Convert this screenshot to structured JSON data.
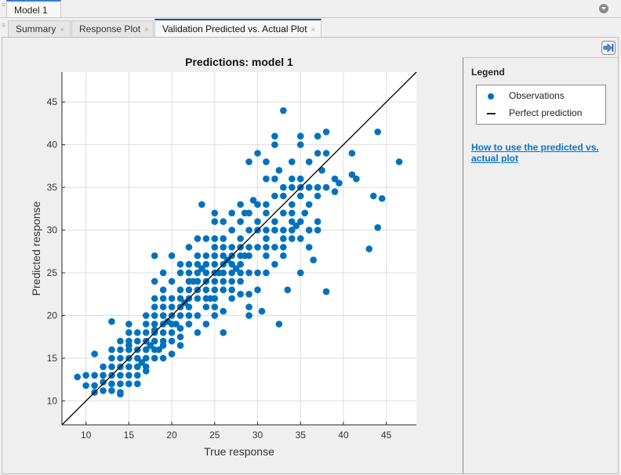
{
  "window": {
    "model_tab": "Model 1",
    "tabs": [
      {
        "label": "Summary",
        "close": "×",
        "active": false
      },
      {
        "label": "Response Plot",
        "close": "×",
        "active": false
      },
      {
        "label": "Validation Predicted vs. Actual Plot",
        "close": "×",
        "active": true
      }
    ]
  },
  "side_panel": {
    "legend_title": "Legend",
    "legend_items": [
      {
        "label": "Observations",
        "icon": "blue-dot"
      },
      {
        "label": "Perfect prediction",
        "icon": "black-line"
      }
    ],
    "help_link": "How to use the predicted vs. actual plot"
  },
  "colors": {
    "marker": "#0072bd",
    "line": "#000000",
    "link": "#0b73c9"
  },
  "chart_data": {
    "type": "scatter",
    "title": "Predictions: model 1",
    "xlabel": "True response",
    "ylabel": "Predicted response",
    "xlim": [
      7.2,
      48.5
    ],
    "ylim": [
      7.2,
      48.5
    ],
    "xticks": [
      10,
      15,
      20,
      25,
      30,
      35,
      40,
      45
    ],
    "yticks": [
      10,
      15,
      20,
      25,
      30,
      35,
      40,
      45
    ],
    "grid": true,
    "series": [
      {
        "name": "Observations",
        "kind": "scatter",
        "points": [
          [
            9,
            12.8
          ],
          [
            10,
            13
          ],
          [
            11,
            13
          ],
          [
            11,
            15.5
          ],
          [
            10,
            11.8
          ],
          [
            11,
            11.8
          ],
          [
            11,
            11
          ],
          [
            12,
            11.2
          ],
          [
            12,
            12.2
          ],
          [
            12,
            13
          ],
          [
            12,
            14
          ],
          [
            13,
            13
          ],
          [
            13,
            14
          ],
          [
            13,
            15
          ],
          [
            13,
            16
          ],
          [
            13,
            12
          ],
          [
            13,
            11.2
          ],
          [
            13,
            19.3
          ],
          [
            14,
            11
          ],
          [
            14,
            12
          ],
          [
            14,
            13
          ],
          [
            14,
            14
          ],
          [
            14,
            15
          ],
          [
            14,
            16
          ],
          [
            14,
            17
          ],
          [
            14,
            10.8
          ],
          [
            15,
            12
          ],
          [
            15,
            13
          ],
          [
            15,
            14
          ],
          [
            15,
            15
          ],
          [
            15,
            16
          ],
          [
            15,
            17
          ],
          [
            15,
            18
          ],
          [
            15,
            19
          ],
          [
            15,
            16.5
          ],
          [
            16,
            13
          ],
          [
            16,
            14
          ],
          [
            16,
            15
          ],
          [
            16,
            16
          ],
          [
            16,
            17
          ],
          [
            16,
            18
          ],
          [
            16,
            12
          ],
          [
            16.5,
            14.5
          ],
          [
            17,
            15
          ],
          [
            17,
            16
          ],
          [
            17,
            17
          ],
          [
            17,
            18
          ],
          [
            17,
            19
          ],
          [
            17,
            20
          ],
          [
            17,
            14
          ],
          [
            17,
            13.5
          ],
          [
            17.5,
            16.5
          ],
          [
            18,
            15
          ],
          [
            18,
            16
          ],
          [
            18,
            17
          ],
          [
            18,
            18
          ],
          [
            18,
            19
          ],
          [
            18,
            20
          ],
          [
            18,
            21
          ],
          [
            18,
            22
          ],
          [
            18,
            24
          ],
          [
            18,
            27
          ],
          [
            18,
            18.3
          ],
          [
            18.5,
            16
          ],
          [
            19,
            16.5
          ],
          [
            19,
            17
          ],
          [
            19,
            18
          ],
          [
            19,
            19
          ],
          [
            19,
            20
          ],
          [
            19,
            21
          ],
          [
            19,
            22
          ],
          [
            19,
            23
          ],
          [
            19,
            25
          ],
          [
            19,
            15
          ],
          [
            19.5,
            19.3
          ],
          [
            20,
            17
          ],
          [
            20,
            18
          ],
          [
            20,
            19
          ],
          [
            20,
            20
          ],
          [
            20,
            21
          ],
          [
            20,
            22
          ],
          [
            20,
            24
          ],
          [
            20,
            27
          ],
          [
            20,
            15.5
          ],
          [
            20.5,
            19
          ],
          [
            21,
            17.5
          ],
          [
            21,
            18.5
          ],
          [
            21,
            20
          ],
          [
            21,
            21
          ],
          [
            21,
            22
          ],
          [
            21,
            23
          ],
          [
            21,
            25
          ],
          [
            21,
            26
          ],
          [
            21,
            16.5
          ],
          [
            21.5,
            21.5
          ],
          [
            22,
            19
          ],
          [
            22,
            20
          ],
          [
            22,
            21
          ],
          [
            22,
            22
          ],
          [
            22,
            23
          ],
          [
            22,
            24
          ],
          [
            22,
            25
          ],
          [
            22,
            26
          ],
          [
            22,
            28
          ],
          [
            22.5,
            24
          ],
          [
            23,
            18
          ],
          [
            23,
            20
          ],
          [
            23,
            22
          ],
          [
            23,
            23
          ],
          [
            23,
            24
          ],
          [
            23,
            25
          ],
          [
            23,
            26
          ],
          [
            23,
            27
          ],
          [
            23,
            29
          ],
          [
            23.5,
            33
          ],
          [
            23.5,
            25.5
          ],
          [
            24,
            19
          ],
          [
            24,
            21
          ],
          [
            24,
            22
          ],
          [
            24,
            23
          ],
          [
            24,
            24
          ],
          [
            24,
            25
          ],
          [
            24,
            26
          ],
          [
            24,
            27
          ],
          [
            24,
            29
          ],
          [
            24.5,
            22
          ],
          [
            25,
            20
          ],
          [
            25,
            21
          ],
          [
            25,
            22
          ],
          [
            25,
            23
          ],
          [
            25,
            24
          ],
          [
            25,
            25
          ],
          [
            25,
            26
          ],
          [
            25,
            27
          ],
          [
            25,
            28
          ],
          [
            25,
            29
          ],
          [
            25,
            31
          ],
          [
            25,
            32
          ],
          [
            25.5,
            25
          ],
          [
            26,
            20.5
          ],
          [
            26,
            23
          ],
          [
            26,
            24
          ],
          [
            26,
            25
          ],
          [
            26,
            26
          ],
          [
            26,
            27
          ],
          [
            26,
            28
          ],
          [
            26,
            29
          ],
          [
            26,
            31
          ],
          [
            26,
            18
          ],
          [
            26.5,
            26.5
          ],
          [
            27,
            22
          ],
          [
            27,
            23
          ],
          [
            27,
            24
          ],
          [
            27,
            25
          ],
          [
            27,
            26
          ],
          [
            27,
            27
          ],
          [
            27,
            28
          ],
          [
            27,
            30
          ],
          [
            27,
            32
          ],
          [
            27.5,
            25.5
          ],
          [
            28,
            22.5
          ],
          [
            28,
            24
          ],
          [
            28,
            25
          ],
          [
            28,
            26
          ],
          [
            28,
            27
          ],
          [
            28,
            28
          ],
          [
            28,
            29
          ],
          [
            28,
            31
          ],
          [
            28,
            33
          ],
          [
            28.5,
            27
          ],
          [
            28.5,
            32
          ],
          [
            29,
            20
          ],
          [
            29,
            22.5
          ],
          [
            29,
            25
          ],
          [
            29,
            27
          ],
          [
            29,
            28
          ],
          [
            29,
            30
          ],
          [
            29,
            32
          ],
          [
            29,
            38
          ],
          [
            29,
            21
          ],
          [
            29.5,
            33.5
          ],
          [
            30,
            23
          ],
          [
            30,
            25
          ],
          [
            30,
            28
          ],
          [
            30,
            30
          ],
          [
            30,
            31
          ],
          [
            30,
            33
          ],
          [
            30,
            39
          ],
          [
            30.5,
            20.5
          ],
          [
            31,
            25
          ],
          [
            31,
            27
          ],
          [
            31,
            28
          ],
          [
            31,
            29
          ],
          [
            31,
            30
          ],
          [
            31,
            32
          ],
          [
            31,
            33
          ],
          [
            31,
            36
          ],
          [
            31,
            38
          ],
          [
            32,
            26
          ],
          [
            32,
            28
          ],
          [
            32,
            30
          ],
          [
            32,
            31
          ],
          [
            32,
            34
          ],
          [
            32,
            36
          ],
          [
            32,
            40
          ],
          [
            32,
            41
          ],
          [
            32.5,
            37
          ],
          [
            32.5,
            19
          ],
          [
            33,
            27
          ],
          [
            33,
            28
          ],
          [
            33,
            29
          ],
          [
            33,
            30
          ],
          [
            33,
            32
          ],
          [
            33,
            34
          ],
          [
            33,
            35
          ],
          [
            33,
            44
          ],
          [
            33.5,
            23
          ],
          [
            34,
            29
          ],
          [
            34,
            30
          ],
          [
            34,
            31
          ],
          [
            34,
            32
          ],
          [
            34,
            33
          ],
          [
            34,
            35
          ],
          [
            34,
            36
          ],
          [
            34,
            38
          ],
          [
            34.5,
            30.5
          ],
          [
            35,
            25
          ],
          [
            35,
            29
          ],
          [
            35,
            31
          ],
          [
            35,
            34
          ],
          [
            35,
            35
          ],
          [
            35,
            36
          ],
          [
            35,
            40
          ],
          [
            35,
            41
          ],
          [
            35.5,
            32
          ],
          [
            36,
            28
          ],
          [
            36,
            30
          ],
          [
            36,
            33
          ],
          [
            36,
            35
          ],
          [
            36,
            38
          ],
          [
            36.5,
            26.5
          ],
          [
            37,
            30
          ],
          [
            37,
            31
          ],
          [
            37,
            34
          ],
          [
            37,
            35
          ],
          [
            37,
            39
          ],
          [
            37,
            41
          ],
          [
            37.5,
            37
          ],
          [
            38,
            22.8
          ],
          [
            38,
            35
          ],
          [
            38,
            39
          ],
          [
            38,
            41.5
          ],
          [
            39,
            34.5
          ],
          [
            39,
            36
          ],
          [
            39.5,
            35.5
          ],
          [
            41,
            36.5
          ],
          [
            41,
            39
          ],
          [
            41.5,
            36
          ],
          [
            43,
            27.8
          ],
          [
            43.5,
            34
          ],
          [
            44,
            30.3
          ],
          [
            44,
            41.5
          ],
          [
            44.5,
            33.7
          ],
          [
            46.5,
            38
          ]
        ]
      },
      {
        "name": "Perfect prediction",
        "kind": "line",
        "points": [
          [
            7.2,
            7.2
          ],
          [
            48.5,
            48.5
          ]
        ]
      }
    ]
  }
}
